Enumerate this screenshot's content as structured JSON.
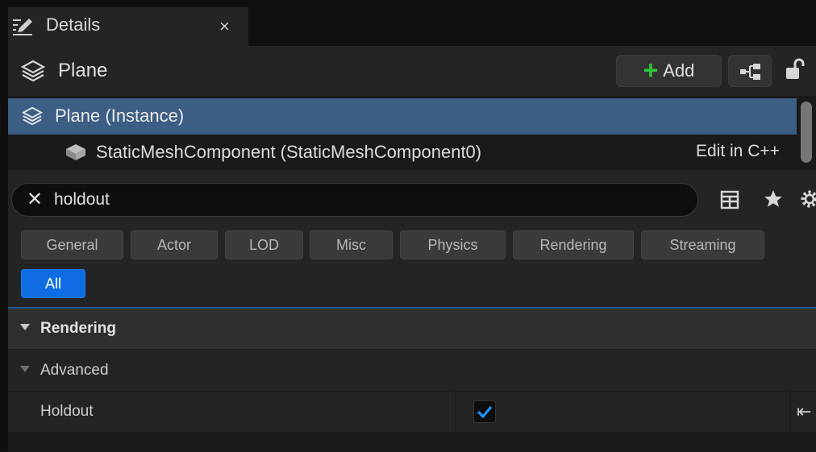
{
  "tab": {
    "title": "Details",
    "close": "×"
  },
  "header": {
    "actor_name": "Plane",
    "add_label": "Add"
  },
  "tree": {
    "selected": "Plane (Instance)",
    "component": "StaticMeshComponent (StaticMeshComponent0)",
    "edit_label": "Edit in C++"
  },
  "search": {
    "value": "holdout",
    "clear": "✕"
  },
  "filters": [
    "General",
    "Actor",
    "LOD",
    "Misc",
    "Physics",
    "Rendering",
    "Streaming",
    "All"
  ],
  "active_filter": "All",
  "details": {
    "category": "Rendering",
    "subcategory": "Advanced",
    "property_label": "Holdout",
    "property_checked": true,
    "reset_glyph": "⇤"
  },
  "colors": {
    "accent": "#0f6de3",
    "selection": "#3c5e85",
    "add_green": "#2fc436",
    "check_blue": "#1e90ff"
  }
}
